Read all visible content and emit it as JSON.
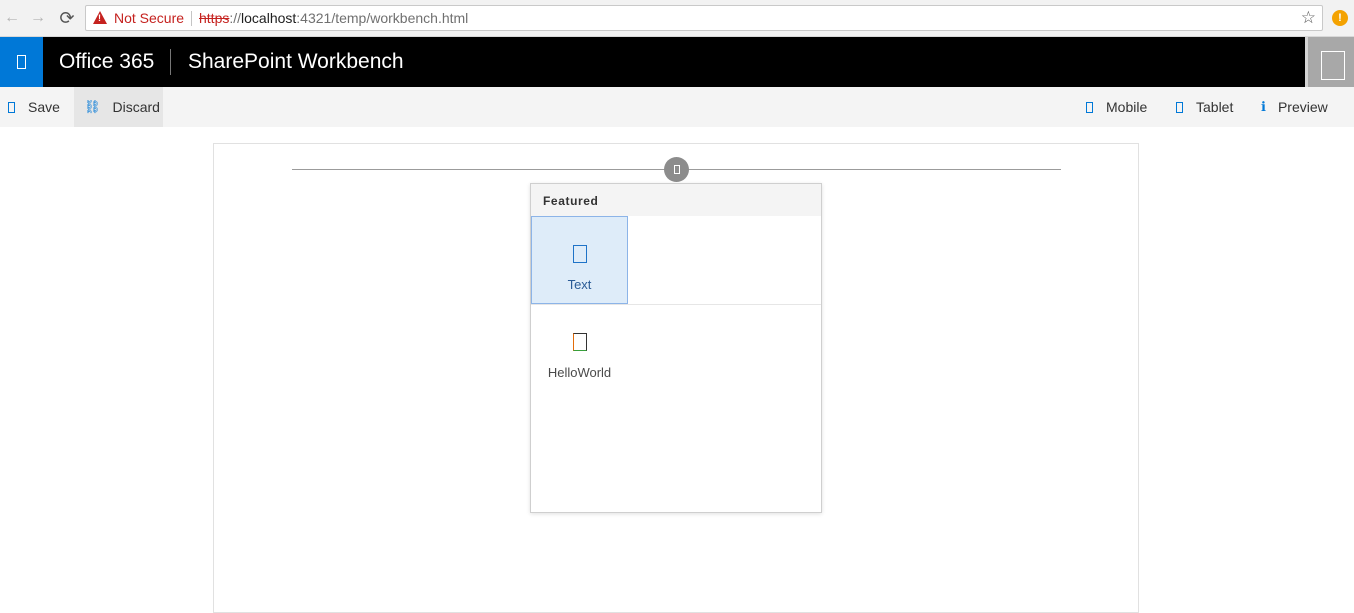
{
  "browser": {
    "back_icon": "←",
    "forward_icon": "→",
    "reload_icon": "⟳",
    "security_label": "Not Secure",
    "url_scheme": "https",
    "url_sep": "://",
    "url_host": "localhost",
    "url_rest": ":4321/temp/workbench.html",
    "star_icon": "☆",
    "alert_icon": "!"
  },
  "suite_bar": {
    "brand": "Office 365",
    "title": "SharePoint Workbench",
    "accent_color": "#0078d7"
  },
  "command_bar": {
    "save_label": "Save",
    "discard_label": "Discard",
    "discard_icon": "⛓",
    "mobile_label": "Mobile",
    "tablet_label": "Tablet",
    "preview_label": "Preview",
    "preview_icon": "ℹ"
  },
  "toolbox": {
    "section_label": "Featured",
    "items": [
      {
        "label": "Text",
        "icon": "text-icon",
        "selected": true
      },
      {
        "label": "HelloWorld",
        "icon": "helloworld-icon",
        "selected": false
      }
    ]
  }
}
